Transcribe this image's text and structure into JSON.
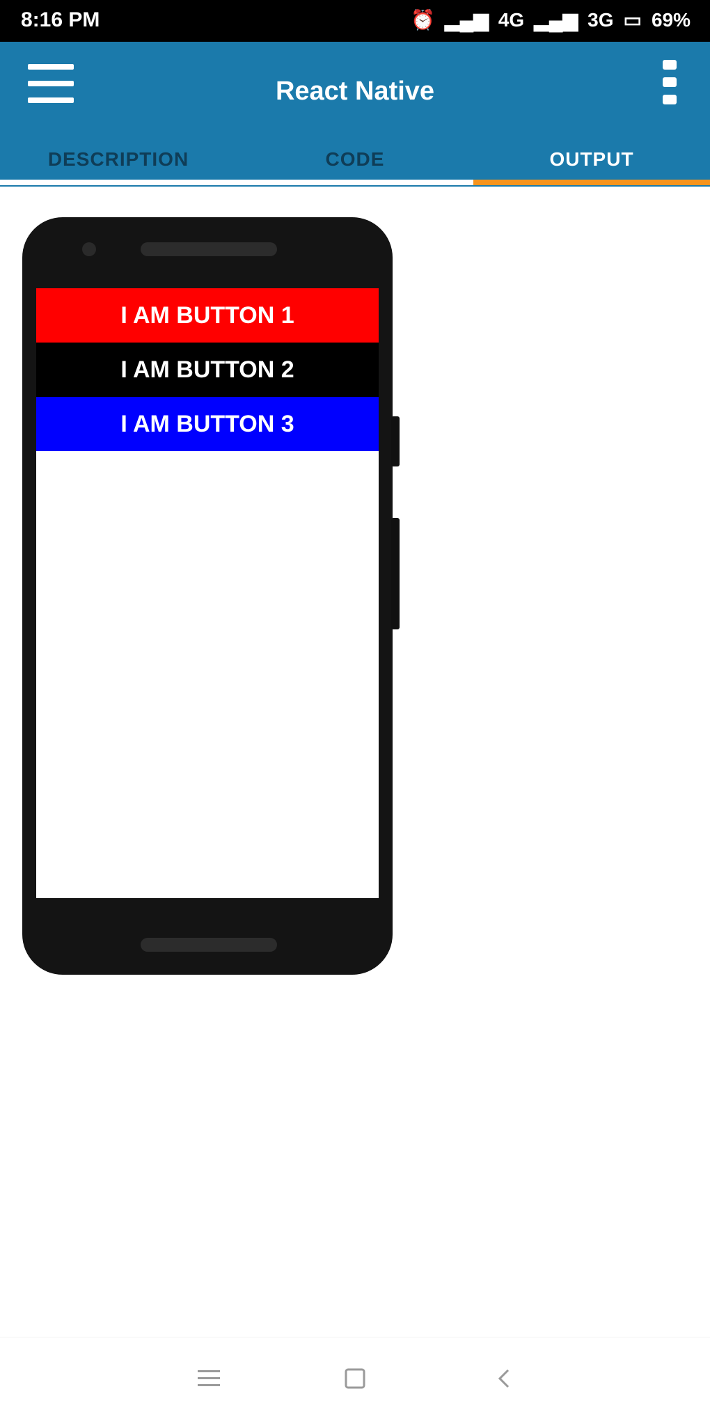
{
  "status_bar": {
    "time": "8:16 PM",
    "network_1": "4G",
    "network_2": "3G",
    "battery": "69%"
  },
  "app_bar": {
    "title": "React Native"
  },
  "tabs": [
    {
      "label": "DESCRIPTION"
    },
    {
      "label": "CODE"
    },
    {
      "label": "OUTPUT"
    }
  ],
  "demo": {
    "buttons": [
      {
        "label": "I AM BUTTON 1",
        "color": "#ff0000"
      },
      {
        "label": "I AM BUTTON 2",
        "color": "#000000"
      },
      {
        "label": "I AM BUTTON 3",
        "color": "#0000ff"
      }
    ]
  },
  "colors": {
    "app_bar": "#1b7aab",
    "tab_indicator": "#f7941d"
  },
  "icons": {
    "menu": "hamburger-icon",
    "overflow": "more-vert-icon",
    "nav_menu": "recents-icon",
    "nav_home": "home-icon",
    "nav_back": "back-icon"
  }
}
